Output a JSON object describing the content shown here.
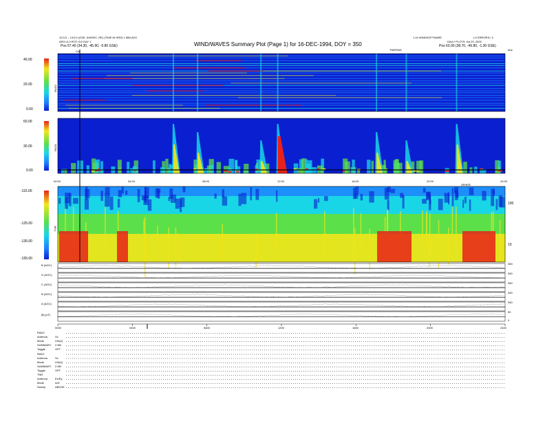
{
  "header": {
    "title": "WIND/WAVES Summary Plot (Page 1) for 16-DEC-1994, DOY = 350",
    "left_line1": "12:0:0 – 13:0:0  (GSE, KM/SEC, RE)  (TIME IN HRS)   1 MIN AVG",
    "left_line2": "ARG=0,0  ROT=5:0  DAY 1",
    "left_pos": "Pos    57.40 (34.30, -45.90, -0.80 GSE)",
    "right_top_a": "1.10  WINDSOFTWARE",
    "right_top_b": "LX ERRORS= 0",
    "right_line2": "DAILY  PLOTS: 0ct 29, 2003",
    "right_pos": "Pos    63.00 (38.70, -49.80, -1.30 GSE)",
    "cal_label": "Cal",
    "center_tag": "TNR/RAD",
    "units_corner": "kHz"
  },
  "panels": {
    "rad2": {
      "name": "RAD2",
      "ticks": [
        "40.00",
        "20.00",
        "0.00"
      ]
    },
    "rad1": {
      "name": "RAD1",
      "ticks": [
        "60.00",
        "30.00",
        "0.00"
      ]
    },
    "tnr": {
      "name": "TNR",
      "ticks": [
        "-115.00",
        "-125.00",
        "-135.00",
        "-155.00"
      ],
      "right_ticks": [
        "100",
        "10"
      ],
      "center_tag": "SPHER"
    },
    "time_ticks_mid": [
      "00:00",
      "04:00",
      "08:00",
      "12:00",
      "16:00",
      "20:00",
      "24:00"
    ],
    "time_ticks_bottom": [
      "0000",
      "0400",
      "0800",
      "1200",
      "1600",
      "2000",
      "2400"
    ],
    "mag_rows": [
      {
        "label": "B (AGC)",
        "scale": [
          "260",
          "0"
        ]
      },
      {
        "label": "G (AGC)",
        "scale": [
          "260",
          "0"
        ]
      },
      {
        "label": "C (AGC)",
        "scale": [
          "260",
          "0"
        ]
      },
      {
        "label": "B (AGC)",
        "scale": [
          "260",
          "0"
        ]
      },
      {
        "label": "A (AGC)",
        "scale": [
          "260",
          "0"
        ]
      },
      {
        "label": "|B| (nT)",
        "scale": [
          "50",
          "0"
        ]
      }
    ]
  },
  "settings": [
    {
      "label": "RAD2",
      "value": ""
    },
    {
      "label": "Antenna",
      "value": "Sx"
    },
    {
      "label": "Mode",
      "value": "LIN(4)"
    },
    {
      "label": "SUMMARY",
      "value": "2.5M"
    },
    {
      "label": "Toggle",
      "value": "OFF"
    },
    {
      "label": "RAD1",
      "value": ""
    },
    {
      "label": "Antenna",
      "value": "Sx"
    },
    {
      "label": "Mode",
      "value": "LIN(4)"
    },
    {
      "label": "SUMMARY",
      "value": "2.5M"
    },
    {
      "label": "Toggle",
      "value": "OFF"
    },
    {
      "label": "TNR",
      "value": ""
    },
    {
      "label": "Antenna",
      "value": "Ex/Ey"
    },
    {
      "label": "Mode",
      "value": "A/D"
    },
    {
      "label": "Sweep",
      "value": "ABCDE"
    }
  ],
  "colors": {
    "spectrum_bg": "#0a1fd0",
    "spectrum_mid": "#1e7dff",
    "cyan": "#19d6e6",
    "green": "#5be04a",
    "yellow": "#f2e61a",
    "red": "#e8221a"
  },
  "chart_data": {
    "type": "heatmap",
    "title": "WIND/WAVES Summary Plot (Page 1) for 16-DEC-1994, DOY = 350",
    "xlabel": "",
    "x_range": [
      "00:00",
      "24:00"
    ],
    "panels": [
      {
        "name": "RAD2",
        "colorbar_ticks": [
          40.0,
          20.0,
          0.0
        ]
      },
      {
        "name": "RAD1",
        "colorbar_ticks": [
          60.0,
          30.0,
          0.0
        ]
      },
      {
        "name": "TNR",
        "colorbar_ticks": [
          -115.0,
          -125.0,
          -135.0,
          -155.0
        ],
        "frequency_ticks": [
          100,
          10
        ]
      }
    ],
    "bursts_hours": [
      6.2,
      7.5,
      10.9,
      11.8,
      17.1,
      18.7,
      21.4
    ],
    "line_panels": [
      "B (AGC)",
      "G (AGC)",
      "C (AGC)",
      "B (AGC)",
      "A (AGC)",
      "|B| (nT)"
    ]
  }
}
